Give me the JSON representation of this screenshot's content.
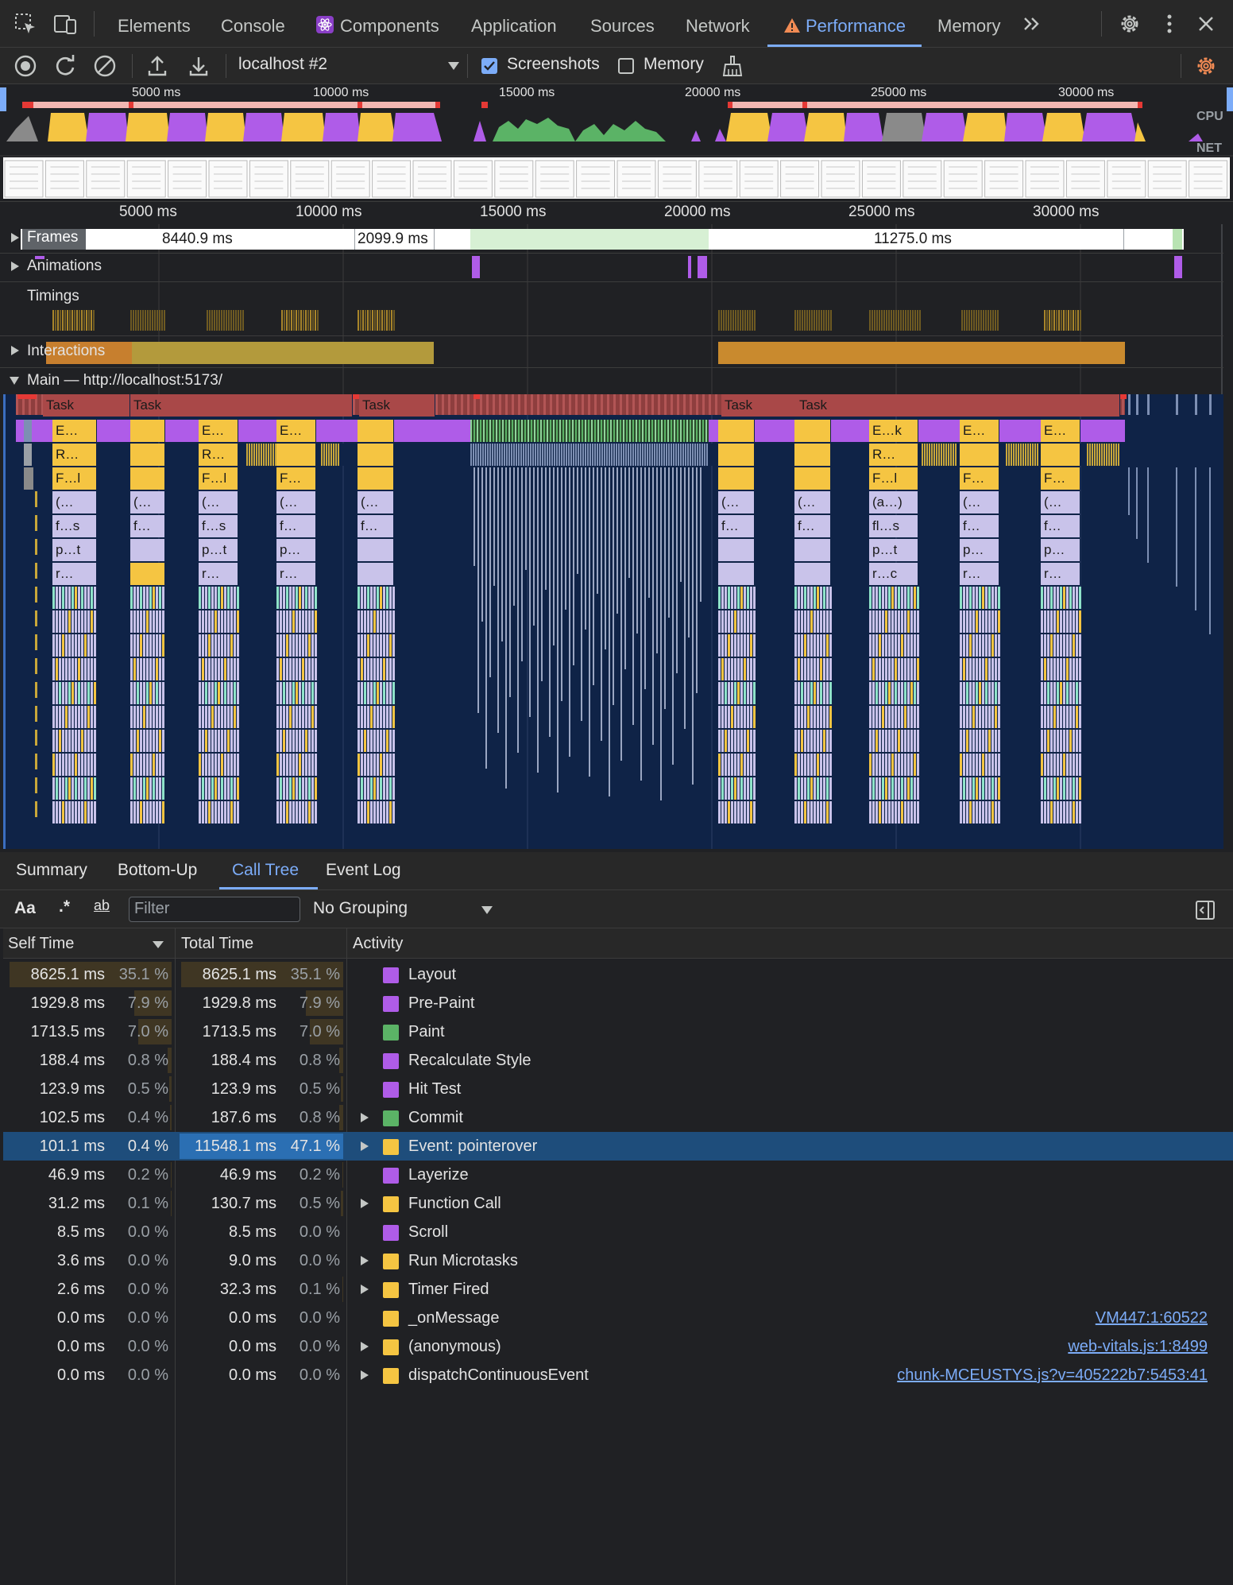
{
  "tabs": [
    {
      "label": "Elements"
    },
    {
      "label": "Console"
    },
    {
      "label": "Components"
    },
    {
      "label": "Application"
    },
    {
      "label": "Sources"
    },
    {
      "label": "Network"
    },
    {
      "label": "Performance"
    },
    {
      "label": "Memory"
    }
  ],
  "toolbar": {
    "target": "localhost #2",
    "screenshots_label": "Screenshots",
    "screenshots_checked": true,
    "memory_label": "Memory",
    "memory_checked": false
  },
  "overview": {
    "ticks": [
      "5000 ms",
      "10000 ms",
      "15000 ms",
      "20000 ms",
      "25000 ms",
      "30000 ms"
    ],
    "cpu_label": "CPU",
    "net_label": "NET"
  },
  "ruler": {
    "ticks": [
      "5000 ms",
      "10000 ms",
      "15000 ms",
      "20000 ms",
      "25000 ms",
      "30000 ms"
    ]
  },
  "tracks": {
    "frames": {
      "title": "Frames",
      "durations": [
        "8440.9 ms",
        "2099.9 ms",
        "11275.0 ms"
      ]
    },
    "animations": {
      "title": "Animations"
    },
    "timings": {
      "title": "Timings"
    },
    "interactions": {
      "title": "Interactions"
    },
    "main": {
      "title": "Main — http://localhost:5173/"
    }
  },
  "flame_labels": {
    "task": "Task",
    "E": "E…",
    "Ek": "E…k",
    "R": "R…",
    "Fl": "F…l",
    "F": "F…",
    "par": "(…",
    "an": "(a…)",
    "f": "f…",
    "fs": "f…s",
    "fls": "fl…s",
    "pt": "p…t",
    "p": "p…",
    "r": "r…",
    "rc": "r…c"
  },
  "bottom_tabs": [
    "Summary",
    "Bottom-Up",
    "Call Tree",
    "Event Log"
  ],
  "filter": {
    "aa": "Aa",
    "regex": ".*",
    "ab": "ab",
    "placeholder": "Filter",
    "grouping": "No Grouping"
  },
  "table": {
    "headers": {
      "self": "Self Time",
      "total": "Total Time",
      "activity": "Activity"
    },
    "rows": [
      {
        "self": "8625.1 ms",
        "self_pct": "35.1 %",
        "total": "8625.1 ms",
        "total_pct": "35.1 %",
        "activity": "Layout",
        "color": "#af5ce8",
        "expandable": false,
        "link": ""
      },
      {
        "self": "1929.8 ms",
        "self_pct": "7.9 %",
        "total": "1929.8 ms",
        "total_pct": "7.9 %",
        "activity": "Pre-Paint",
        "color": "#af5ce8",
        "expandable": false,
        "link": ""
      },
      {
        "self": "1713.5 ms",
        "self_pct": "7.0 %",
        "total": "1713.5 ms",
        "total_pct": "7.0 %",
        "activity": "Paint",
        "color": "#5bb366",
        "expandable": false,
        "link": ""
      },
      {
        "self": "188.4 ms",
        "self_pct": "0.8 %",
        "total": "188.4 ms",
        "total_pct": "0.8 %",
        "activity": "Recalculate Style",
        "color": "#af5ce8",
        "expandable": false,
        "link": ""
      },
      {
        "self": "123.9 ms",
        "self_pct": "0.5 %",
        "total": "123.9 ms",
        "total_pct": "0.5 %",
        "activity": "Hit Test",
        "color": "#af5ce8",
        "expandable": false,
        "link": ""
      },
      {
        "self": "102.5 ms",
        "self_pct": "0.4 %",
        "total": "187.6 ms",
        "total_pct": "0.8 %",
        "activity": "Commit",
        "color": "#5bb366",
        "expandable": true,
        "link": ""
      },
      {
        "self": "101.1 ms",
        "self_pct": "0.4 %",
        "total": "11548.1 ms",
        "total_pct": "47.1 %",
        "activity": "Event: pointerover",
        "color": "#f5c542",
        "expandable": true,
        "link": "",
        "selected": true
      },
      {
        "self": "46.9 ms",
        "self_pct": "0.2 %",
        "total": "46.9 ms",
        "total_pct": "0.2 %",
        "activity": "Layerize",
        "color": "#af5ce8",
        "expandable": false,
        "link": ""
      },
      {
        "self": "31.2 ms",
        "self_pct": "0.1 %",
        "total": "130.7 ms",
        "total_pct": "0.5 %",
        "activity": "Function Call",
        "color": "#f5c542",
        "expandable": true,
        "link": ""
      },
      {
        "self": "8.5 ms",
        "self_pct": "0.0 %",
        "total": "8.5 ms",
        "total_pct": "0.0 %",
        "activity": "Scroll",
        "color": "#af5ce8",
        "expandable": false,
        "link": ""
      },
      {
        "self": "3.6 ms",
        "self_pct": "0.0 %",
        "total": "9.0 ms",
        "total_pct": "0.0 %",
        "activity": "Run Microtasks",
        "color": "#f5c542",
        "expandable": true,
        "link": ""
      },
      {
        "self": "2.6 ms",
        "self_pct": "0.0 %",
        "total": "32.3 ms",
        "total_pct": "0.1 %",
        "activity": "Timer Fired",
        "color": "#f5c542",
        "expandable": true,
        "link": ""
      },
      {
        "self": "0.0 ms",
        "self_pct": "0.0 %",
        "total": "0.0 ms",
        "total_pct": "0.0 %",
        "activity": "_onMessage",
        "color": "#f5c542",
        "expandable": false,
        "link": "VM447:1:60522"
      },
      {
        "self": "0.0 ms",
        "self_pct": "0.0 %",
        "total": "0.0 ms",
        "total_pct": "0.0 %",
        "activity": "(anonymous)",
        "color": "#f5c542",
        "expandable": true,
        "link": "web-vitals.js:1:8499"
      },
      {
        "self": "0.0 ms",
        "self_pct": "0.0 %",
        "total": "0.0 ms",
        "total_pct": "0.0 %",
        "activity": "dispatchContinuousEvent",
        "color": "#f5c542",
        "expandable": true,
        "link": "chunk-MCEUSTYS.js?v=405222b7:5453:41"
      }
    ]
  },
  "colors": {
    "accent": "#7cacf8",
    "scripting": "#f5c542",
    "rendering": "#af5ce8",
    "painting": "#5bb366",
    "warning": "#f28b54",
    "flame_bg": "#0f2347",
    "selected_row": "#1e4d7b"
  }
}
